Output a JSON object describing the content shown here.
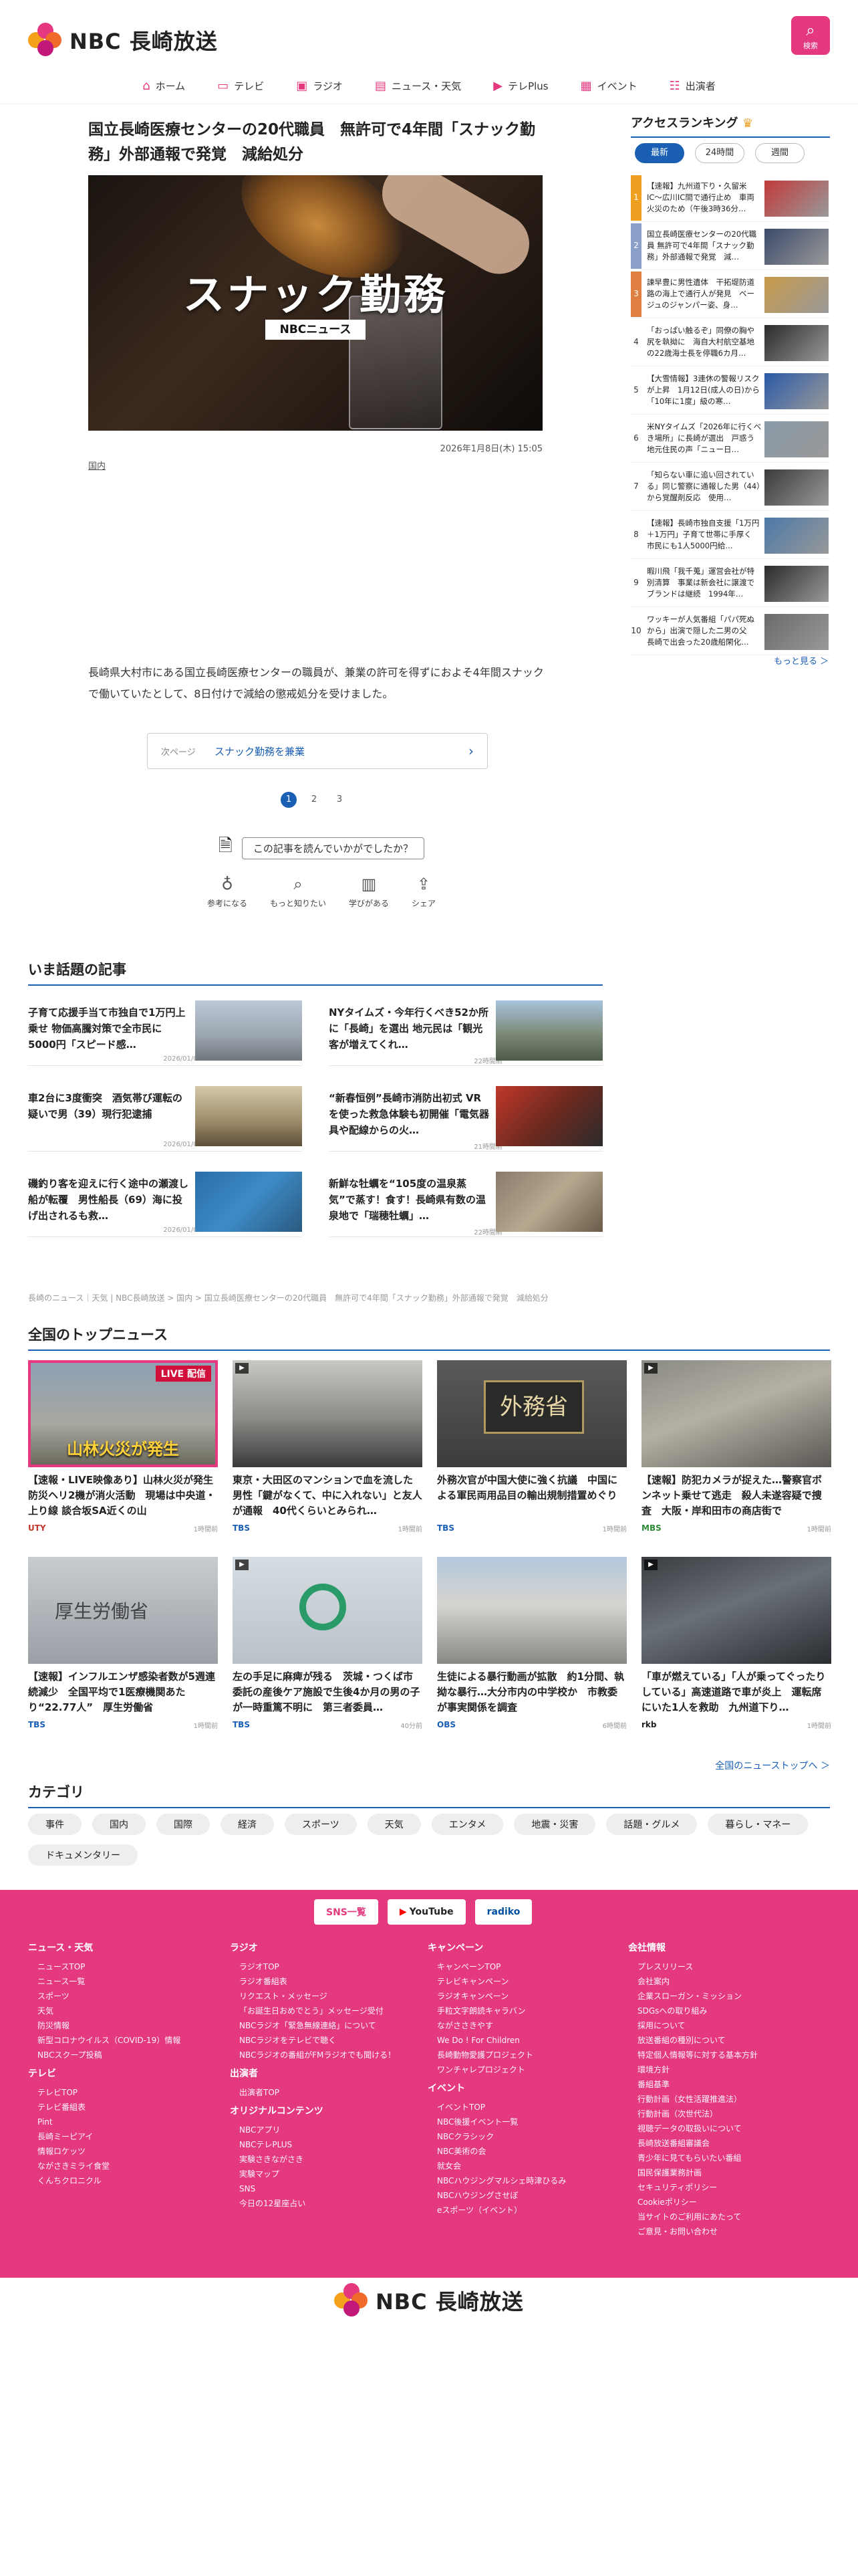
{
  "header": {
    "logo_text": "NBC 長崎放送",
    "search_label": "検索",
    "brand_color": "#e4387f"
  },
  "nav": [
    {
      "label": "ホーム",
      "icon": "home-icon"
    },
    {
      "label": "テレビ",
      "icon": "tv-icon"
    },
    {
      "label": "ラジオ",
      "icon": "radio-icon"
    },
    {
      "label": "ニュース・天気",
      "icon": "news-icon"
    },
    {
      "label": "テレPlus",
      "icon": "play-icon"
    },
    {
      "label": "イベント",
      "icon": "calendar-icon"
    },
    {
      "label": "出演者",
      "icon": "people-icon"
    }
  ],
  "article": {
    "title": "国立長崎医療センターの20代職員　無許可で4年間「スナック勤務」外部通報で発覚　減給処分",
    "hero_caption": "スナック勤務",
    "hero_tag": "NBCニュース",
    "date": "2026年1月8日(木) 15:05",
    "category": "国内",
    "body": "長崎県大村市にある国立長崎医療センターの職員が、兼業の許可を得ずにおよそ4年間スナックで働いていたとして、8日付けで減給の懲戒処分を受けました。",
    "next_label": "次ページ",
    "next_link": "スナック勤務を兼業",
    "pages": [
      "1",
      "2",
      "3"
    ]
  },
  "feedback": {
    "question": "この記事を読んでいかがでしたか？",
    "buttons": [
      {
        "label": "参考になる",
        "icon": "lightbulb-icon"
      },
      {
        "label": "もっと知りたい",
        "icon": "magnifier-icon"
      },
      {
        "label": "学びがある",
        "icon": "book-icon"
      },
      {
        "label": "シェア",
        "icon": "share-icon"
      }
    ]
  },
  "hot": {
    "title": "いま話題の記事",
    "items": [
      {
        "title": "子育て応援手当て市独自で1万円上乗せ 物価高騰対策で全市民に5000円「スピード感…",
        "date": "2026/01/04"
      },
      {
        "title": "NYタイムズ・今年行くべき52か所に「長崎」を選出 地元民は「観光客が増えてくれ…",
        "date": "22時間前"
      },
      {
        "title": "車2台に3度衝突　酒気帯び運転の疑いで男（39）現行犯逮捕",
        "date": "2026/01/02"
      },
      {
        "title": "“新春恒例”長崎市消防出初式 VRを使った救急体験も初開催「電気器具や配線からの火…",
        "date": "21時間前"
      },
      {
        "title": "磯釣り客を迎えに行く途中の瀬渡し船が転覆　男性船長（69）海に投げ出されるも救…",
        "date": "2026/01/04"
      },
      {
        "title": "新鮮な牡蠣を“105度の温泉蒸気”で蒸す！食す！長崎県有数の温泉地で「瑞穂牡蠣」…",
        "date": "22時間前"
      }
    ]
  },
  "breadcrumb": "長崎のニュース｜天気 | NBC長崎放送 > 国内 > 国立長崎医療センターの20代職員　無許可で4年間「スナック勤務」外部通報で発覚　減給処分",
  "top_news": {
    "title": "全国のトップニュース",
    "items": [
      {
        "title": "【速報・LIVE映像あり】山林火災が発生　防災ヘリ2機が消火活動　現場は中央道・上り線 談合坂SA近くの山",
        "source": "UTY",
        "time": "1時間前",
        "img_text": "山林火災が発生"
      },
      {
        "title": "東京・大田区のマンションで血を流した男性「鍵がなくて、中に入れない」と友人が通報　40代くらいとみられ…",
        "source": "TBS",
        "time": "1時間前",
        "img_text": ""
      },
      {
        "title": "外務次官が中国大使に強く抗議　中国による軍民両用品目の輸出規制措置めぐり",
        "source": "TBS",
        "time": "1時間前",
        "img_text": "外務省"
      },
      {
        "title": "【速報】防犯カメラが捉えた…警察官ボンネット乗せて逃走　殺人未遂容疑で捜査　大阪・岸和田市の商店街で",
        "source": "MBS",
        "time": "1時間前",
        "img_text": ""
      },
      {
        "title": "【速報】インフルエンザ感染者数が5週連続減少　全国平均で1医療機関あたり“22.77人”　厚生労働省",
        "source": "TBS",
        "time": "1時間前",
        "img_text": "厚生労働省"
      },
      {
        "title": "左の手足に麻痺が残る　茨城・つくば市委託の産後ケア施設で生後4か月の男の子が一時重篤不明に　第三者委員…",
        "source": "TBS",
        "time": "40分前",
        "img_text": ""
      },
      {
        "title": "生徒による暴行動画が拡散　約1分間、執拗な暴行…大分市内の中学校か　市教委が事実関係を調査",
        "source": "OBS",
        "time": "6時間前",
        "img_text": ""
      },
      {
        "title": "「車が燃えている」「人が乗ってぐったりしている」高速道路で車が炎上　運転席にいた1人を救助　九州道下り…",
        "source": "rkb",
        "time": "1時間前",
        "img_text": ""
      }
    ],
    "more": "全国のニューストップへ ＞"
  },
  "categories": {
    "title": "カテゴリ",
    "items": [
      "事件",
      "国内",
      "国際",
      "経済",
      "スポーツ",
      "天気",
      "エンタメ",
      "地震・災害",
      "話題・グルメ",
      "暮らし・マネー",
      "ドキュメンタリー"
    ]
  },
  "footer": {
    "sns": [
      "SNS一覧",
      "YouTube",
      "radiko"
    ],
    "cols": [
      {
        "groups": [
          {
            "heading": "ニュース・天気",
            "links": [
              "ニュースTOP",
              "ニュース一覧",
              "スポーツ",
              "天気",
              "防災情報",
              "新型コロナウイルス（COVID-19）情報",
              "NBCスクープ投稿"
            ]
          },
          {
            "heading": "テレビ",
            "links": [
              "テレビTOP",
              "テレビ番組表",
              "Pint",
              "長崎ミーピアイ",
              "情報ロケッツ",
              "ながさきミライ食堂",
              "くんちクロニクル"
            ]
          }
        ]
      },
      {
        "groups": [
          {
            "heading": "ラジオ",
            "links": [
              "ラジオTOP",
              "ラジオ番組表",
              "リクエスト・メッセージ",
              "「お誕生日おめでとう」メッセージ受付",
              "NBCラジオ「緊急無線連絡」について",
              "NBCラジオをテレビで聴く",
              "NBCラジオの番組がFMラジオでも聞ける！"
            ]
          },
          {
            "heading": "出演者",
            "links": [
              "出演者TOP"
            ]
          },
          {
            "heading": "オリジナルコンテンツ",
            "links": [
              "NBCアプリ",
              "NBCテレPLUS",
              "実験さきながさき",
              "実験マップ",
              "SNS",
              "今日の12星座占い"
            ]
          }
        ]
      },
      {
        "groups": [
          {
            "heading": "キャンペーン",
            "links": [
              "キャンペーンTOP",
              "テレビキャンペーン",
              "ラジオキャンペーン",
              "手粒文字朗読キャラバン",
              "ながささきやす",
              "We Do ! For Children",
              "長崎動物愛護プロジェクト",
              "ワンチャレプロジェクト"
            ]
          },
          {
            "heading": "イベント",
            "links": [
              "イベントTOP",
              "NBC後援イベント一覧",
              "NBCクラシック",
              "NBC美術の会",
              "就女会",
              "NBCハウジングマルシェ時津ひるみ",
              "NBCハウジングさせぼ",
              "eスポーツ（イベント）"
            ]
          }
        ]
      },
      {
        "groups": [
          {
            "heading": "会社情報",
            "links": [
              "プレスリリース",
              "会社案内",
              "企業スローガン・ミッション",
              "SDGsへの取り組み",
              "採用について",
              "放送番組の種別について",
              "特定個人情報等に対する基本方針",
              "環境方針",
              "番組基準",
              "行動計画（女性活躍推進法）",
              "行動計画（次世代法）",
              "視聴データの取扱いについて",
              "長崎放送番組審議会",
              "青少年に見てもらいたい番組",
              "国民保護業務計画",
              "セキュリティポリシー",
              "Cookieポリシー",
              "当サイトのご利用にあたって",
              "ご意見・お問い合わせ"
            ]
          }
        ]
      }
    ],
    "logo_text": "NBC 長崎放送"
  },
  "ranking": {
    "title": "アクセスランキング",
    "tabs": [
      "最新",
      "24時間",
      "週間"
    ],
    "items": [
      {
        "num": "1",
        "title": "【速報】九州道下り・久留米IC〜広川IC間で通行止め　車両火災のため（午後3時36分…",
        "color": "#f0a020"
      },
      {
        "num": "2",
        "title": "国立長崎医療センターの20代職員 無許可で4年間「スナック勤務」外部通報で発覚　減…",
        "color": "#8aa0c8"
      },
      {
        "num": "3",
        "title": "諫早豊に男性遺体　干拓堤防道路の海上で通行人が発見　ベージュのジャンパー姿、身…",
        "color": "#e08040"
      },
      {
        "num": "4",
        "title": "「おっぱい触るぞ」同僚の胸や尻を執拗に　海自大村航空基地の22歳海士長を停職6カ月…",
        "color": ""
      },
      {
        "num": "5",
        "title": "【大雪情報】3連休の警報リスクが上昇　1月12日(成人の日)から「10年に1度」級の寒…",
        "color": ""
      },
      {
        "num": "6",
        "title": "米NYタイムズ「2026年に行くべき場所」に長崎が選出　戸惑う地元住民の声「ニュー日…",
        "color": ""
      },
      {
        "num": "7",
        "title": "「知らない車に追い回されている」同じ警察に通報した男（44）から覚醒剤反応　使用…",
        "color": ""
      },
      {
        "num": "8",
        "title": "【速報】長崎市独自支援「1万円＋1万円」子育て世帯に手厚く　市民にも1人5000円給…",
        "color": ""
      },
      {
        "num": "9",
        "title": "暇川飛「我千蒐」運営会社が特別清算　事業は新会社に譲渡でブランドは継続　1994年…",
        "color": ""
      },
      {
        "num": "10",
        "title": "ワッキーが人気番組「パパ死ぬから」出演で隠した二男の父　長崎で出会った20歳船閑化…",
        "color": ""
      }
    ],
    "more": "もっと見る ＞"
  }
}
